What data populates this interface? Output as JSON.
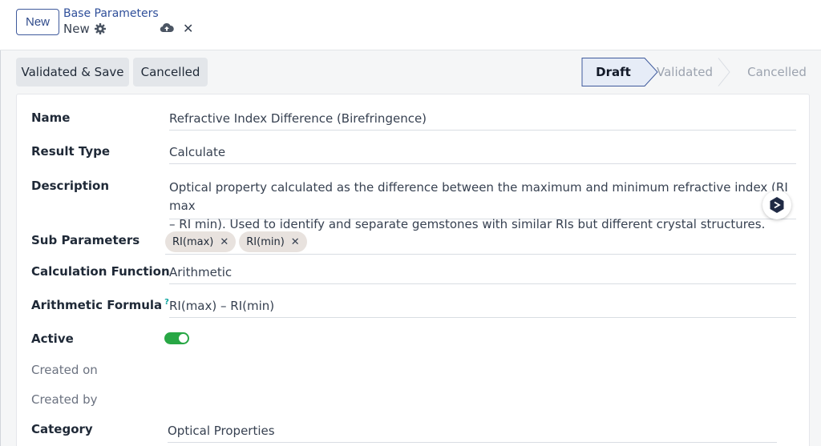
{
  "control_panel": {
    "new_button": "New",
    "breadcrumb_parent": "Base Parameters",
    "breadcrumb_current": "New"
  },
  "header": {
    "buttons": [
      "Validated & Save",
      "Cancelled"
    ],
    "stages": [
      "Draft",
      "Validated",
      "Cancelled"
    ],
    "active_stage": "Draft"
  },
  "form": {
    "name": {
      "label": "Name",
      "value": "Refractive Index Difference (Birefringence)"
    },
    "result_type": {
      "label": "Result Type",
      "value": "Calculate"
    },
    "description": {
      "label": "Description",
      "line1": "Optical property calculated as the difference between the maximum and minimum refractive index (RI max",
      "line2": "– RI min). Used to identify and separate gemstones with similar RIs but different crystal structures."
    },
    "sub_parameters": {
      "label": "Sub Parameters",
      "tags": [
        "RI(max)",
        "RI(min)"
      ]
    },
    "calculation_function": {
      "label": "Calculation Function",
      "value": "Arithmetic"
    },
    "arithmetic_formula": {
      "label": "Arithmetic Formula",
      "help": "?",
      "value": "RI(max) – RI(min)"
    },
    "active": {
      "label": "Active",
      "checked": true
    },
    "created_on": {
      "label": "Created on",
      "value": ""
    },
    "created_by": {
      "label": "Created by",
      "value": ""
    },
    "category": {
      "label": "Category",
      "value": "Optical Properties"
    }
  },
  "icons": [
    "gear-icon",
    "cloud-upload-icon",
    "close-icon",
    "assistant-icon"
  ],
  "colors": {
    "accent": "#3f5a9c",
    "toggle_on": "#28a745",
    "help": "#0ea5a0"
  }
}
